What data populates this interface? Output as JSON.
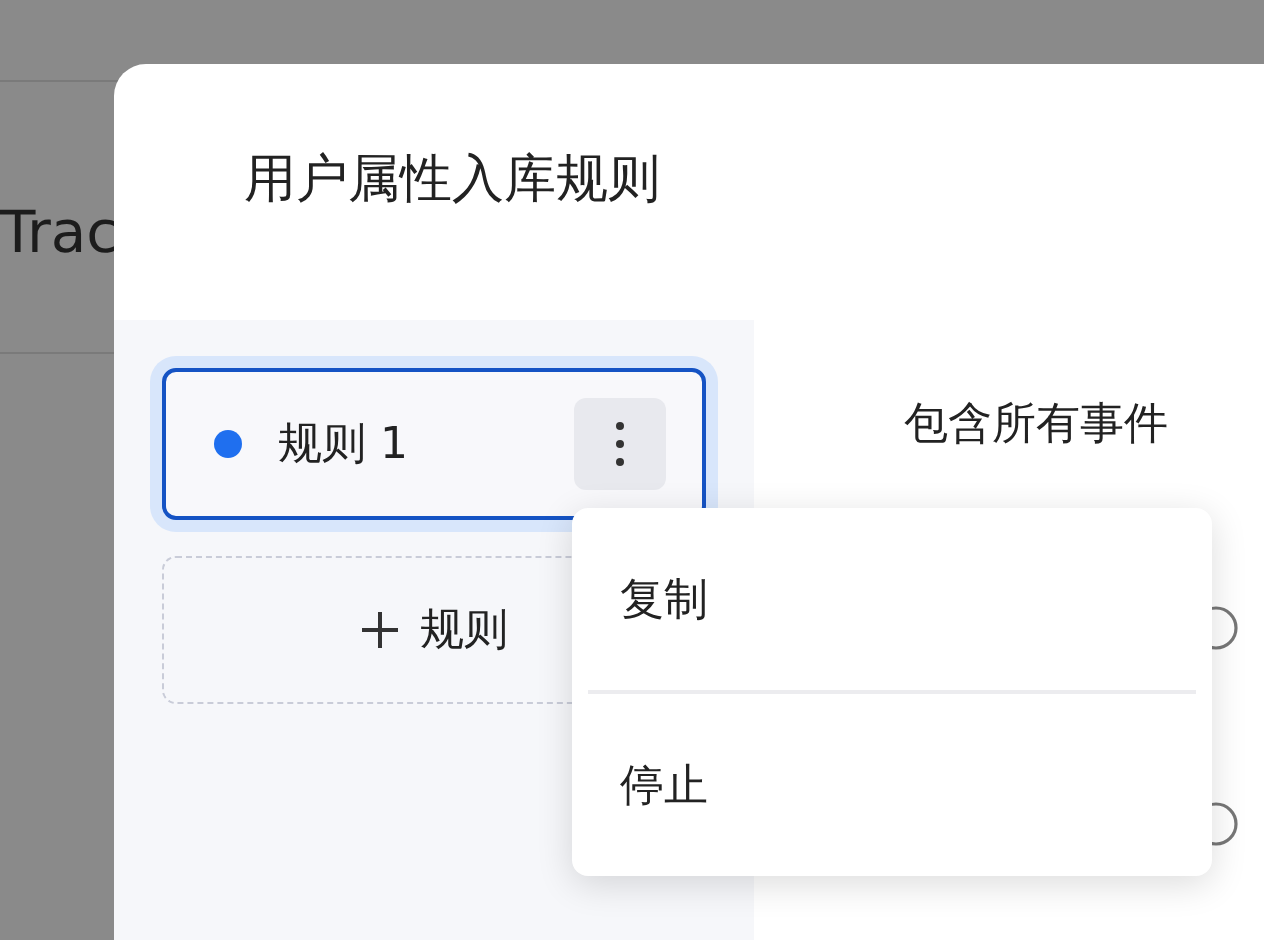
{
  "background": {
    "heading": "Trac"
  },
  "dialog": {
    "title": "用户属性入库规则",
    "rules": [
      {
        "label": "规则 1",
        "selected": true,
        "color": "#1f6fef"
      }
    ],
    "add_button": {
      "label": "规则"
    },
    "content": {
      "label": "包含所有事件"
    },
    "context_menu": [
      {
        "label": "复制"
      },
      {
        "label": "停止"
      }
    ]
  }
}
